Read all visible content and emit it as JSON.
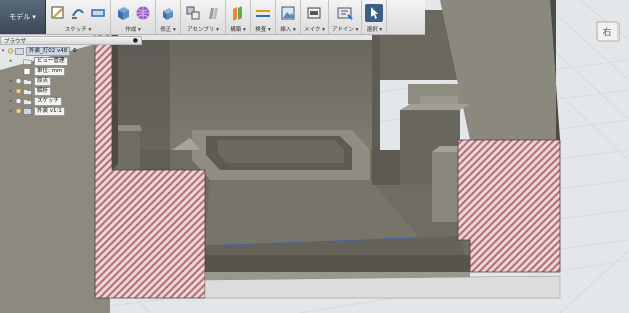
{
  "toolbar": {
    "mode": "モデル ▾",
    "groups": [
      {
        "label": "スケッチ ▾"
      },
      {
        "label": "作成 ▾"
      },
      {
        "label": "修正 ▾"
      },
      {
        "label": "アセンブリ ▾"
      },
      {
        "label": "構築 ▾"
      },
      {
        "label": "検査 ▾"
      },
      {
        "label": "挿入 ▾"
      },
      {
        "label": "メイク ▾"
      },
      {
        "label": "アドイン ▾"
      },
      {
        "label": "選択 ▾"
      }
    ]
  },
  "browser": {
    "title": "ブラウザ",
    "items": [
      {
        "label": "外装_灯02 v48"
      },
      {
        "label": "ビュー管理"
      },
      {
        "label": "単位: mm"
      },
      {
        "label": "原点"
      },
      {
        "label": "解析"
      },
      {
        "label": "スケッチ"
      },
      {
        "label": "外装 v1:1"
      }
    ]
  },
  "viewcube": {
    "label": "右"
  },
  "colors": {
    "hatch": "#c98b93",
    "wall": "#7a776f",
    "floor": "#6c695f",
    "accent": "#3d5f86"
  }
}
